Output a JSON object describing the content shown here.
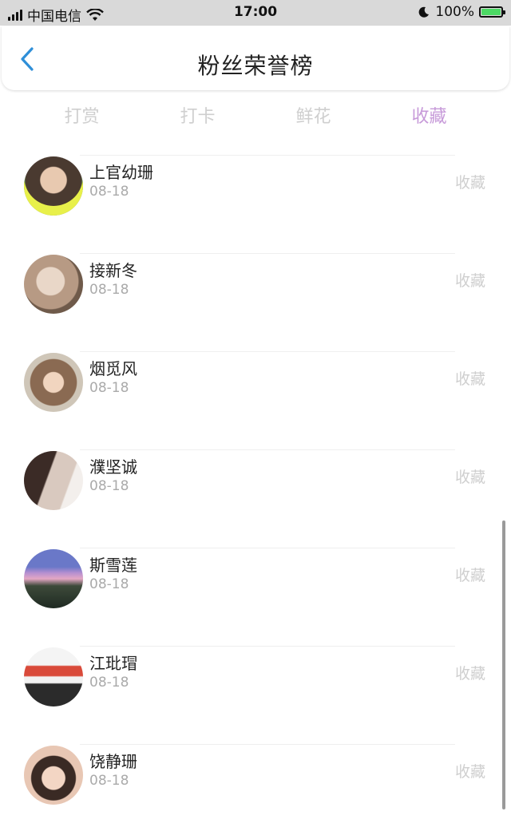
{
  "status_bar": {
    "carrier": "中国电信",
    "time": "17:00",
    "battery": "100%"
  },
  "header": {
    "title": "粉丝荣誉榜"
  },
  "tabs": [
    {
      "label": "打赏"
    },
    {
      "label": "打卡"
    },
    {
      "label": "鲜花"
    },
    {
      "label": "收藏"
    }
  ],
  "active_tab": "收藏",
  "colors": {
    "accent": "#c79ad9",
    "inactive": "#cfcfcf",
    "back": "#2f8fd8"
  },
  "fans": [
    {
      "name": "上官幼珊",
      "date": "08-18",
      "action": "收藏"
    },
    {
      "name": "接新冬",
      "date": "08-18",
      "action": "收藏"
    },
    {
      "name": "烟觅风",
      "date": "08-18",
      "action": "收藏"
    },
    {
      "name": "濮坚诚",
      "date": "08-18",
      "action": "收藏"
    },
    {
      "name": "斯雪莲",
      "date": "08-18",
      "action": "收藏"
    },
    {
      "name": "江玭瑁",
      "date": "08-18",
      "action": "收藏"
    },
    {
      "name": "饶静珊",
      "date": "08-18",
      "action": "收藏"
    }
  ]
}
